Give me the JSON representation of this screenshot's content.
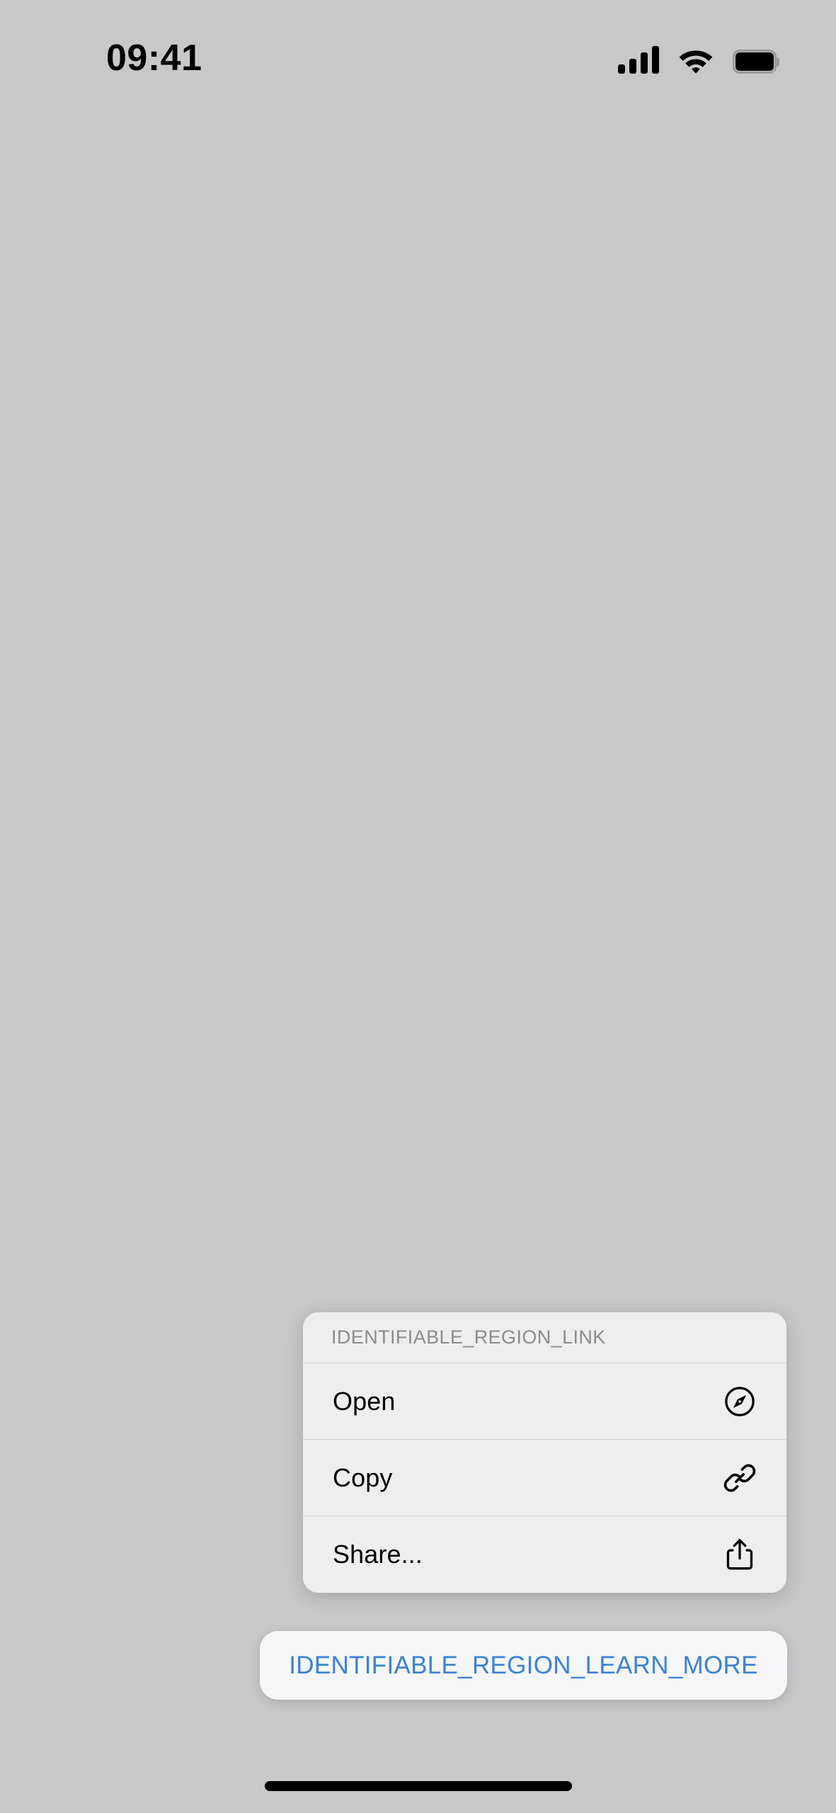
{
  "status_bar": {
    "time": "09:41",
    "icons": [
      {
        "name": "cellular-signal-icon",
        "bars": 4
      },
      {
        "name": "wifi-icon"
      },
      {
        "name": "battery-icon",
        "level": "full"
      }
    ]
  },
  "background_color": "#c6c8cc",
  "action_menu": {
    "header": "IDENTIFIABLE_REGION_LINK",
    "background_color": "#eeeef0",
    "separator_color": "#d3d3d7",
    "items": [
      {
        "label": "Open",
        "icon": "compass-icon"
      },
      {
        "label": "Copy",
        "icon": "link-icon"
      },
      {
        "label": "Share...",
        "icon": "share-icon"
      }
    ]
  },
  "learn_more_button": {
    "label": "IDENTIFIABLE_REGION_LEARN_MORE",
    "text_color": "#3b82d6",
    "background_color": "#f5f6f8"
  },
  "home_indicator": {
    "color": "#000000"
  }
}
